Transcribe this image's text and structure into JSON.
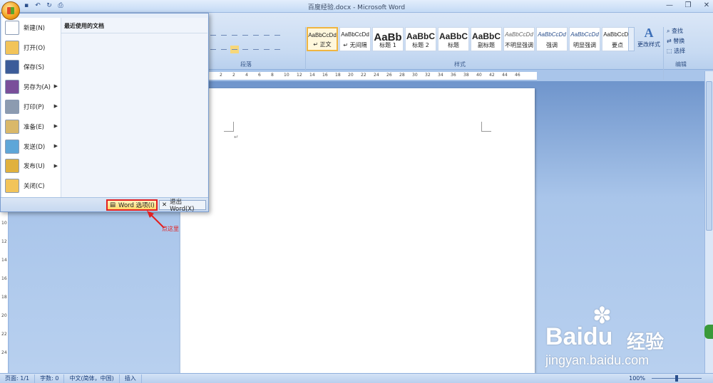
{
  "window": {
    "title": "百度经验.docx - Microsoft Word",
    "controls": [
      "—",
      "❐",
      "✕"
    ]
  },
  "quick_access": [
    "save-icon",
    "undo-icon",
    "redo-icon",
    "print-preview-icon"
  ],
  "ribbon": {
    "groups": [
      {
        "id": "paragraph",
        "label": "段落"
      },
      {
        "id": "styles",
        "label": "样式"
      },
      {
        "id": "editing",
        "label": "编辑"
      }
    ],
    "styles": [
      {
        "sample": "AaBbCcDd",
        "name": "↵ 正文",
        "selected": true
      },
      {
        "sample": "AaBbCcDd",
        "name": "↵ 无间隔"
      },
      {
        "sample": "AaBb",
        "name": "标题 1"
      },
      {
        "sample": "AaBbC",
        "name": "标题 2"
      },
      {
        "sample": "AaBbC",
        "name": "标题"
      },
      {
        "sample": "AaBbC",
        "name": "副标题"
      },
      {
        "sample": "AaBbCcDd",
        "name": "不明显强调"
      },
      {
        "sample": "AaBbCcDd",
        "name": "强调"
      },
      {
        "sample": "AaBbCcDd",
        "name": "明显强调"
      },
      {
        "sample": "AaBbCcDd",
        "name": "要点"
      }
    ],
    "change_styles": "更改样式",
    "editing": [
      "查找",
      "替换",
      "选择"
    ]
  },
  "office_menu": {
    "items": [
      {
        "label": "新建(N)",
        "icon": "new-document-icon",
        "submenu": false,
        "color": "#ffffff"
      },
      {
        "label": "打开(O)",
        "icon": "open-folder-icon",
        "submenu": false,
        "color": "#f2c45a"
      },
      {
        "label": "保存(S)",
        "icon": "save-disk-icon",
        "submenu": false,
        "color": "#3c5c99"
      },
      {
        "label": "另存为(A)",
        "icon": "save-as-icon",
        "submenu": true,
        "color": "#7a4f9a"
      },
      {
        "label": "打印(P)",
        "icon": "printer-icon",
        "submenu": true,
        "color": "#8c9bb0"
      },
      {
        "label": "准备(E)",
        "icon": "prepare-icon",
        "submenu": true,
        "color": "#d9b86a"
      },
      {
        "label": "发送(D)",
        "icon": "send-icon",
        "submenu": true,
        "color": "#5ea6d8"
      },
      {
        "label": "发布(U)",
        "icon": "publish-icon",
        "submenu": true,
        "color": "#e0b13e"
      },
      {
        "label": "关闭(C)",
        "icon": "close-folder-icon",
        "submenu": false,
        "color": "#f2c45a"
      }
    ],
    "recent_title": "最近使用的文档",
    "word_options": "Word 选项(I)",
    "exit_word": "退出 Word(X)"
  },
  "ruler": {
    "h_ticks": [
      "2",
      "2",
      "4",
      "6",
      "8",
      "10",
      "12",
      "14",
      "16",
      "18",
      "20",
      "22",
      "24",
      "26",
      "28",
      "30",
      "32",
      "34",
      "36",
      "38",
      "40",
      "42",
      "44",
      "46"
    ],
    "v_ticks": [
      "10",
      "12",
      "14",
      "16",
      "18",
      "20",
      "22",
      "24"
    ]
  },
  "document": {
    "paragraph_mark": "↵"
  },
  "statusbar": {
    "page": "页面: 1/1",
    "words": "字数: 0",
    "language": "中文(简体，中国)",
    "mode": "插入",
    "zoom": "100%"
  },
  "annotation": {
    "text": "点这里",
    "color": "#e22020"
  },
  "watermark": {
    "logo": "Baidu",
    "cn": "经验",
    "url": "jingyan.baidu.com"
  }
}
